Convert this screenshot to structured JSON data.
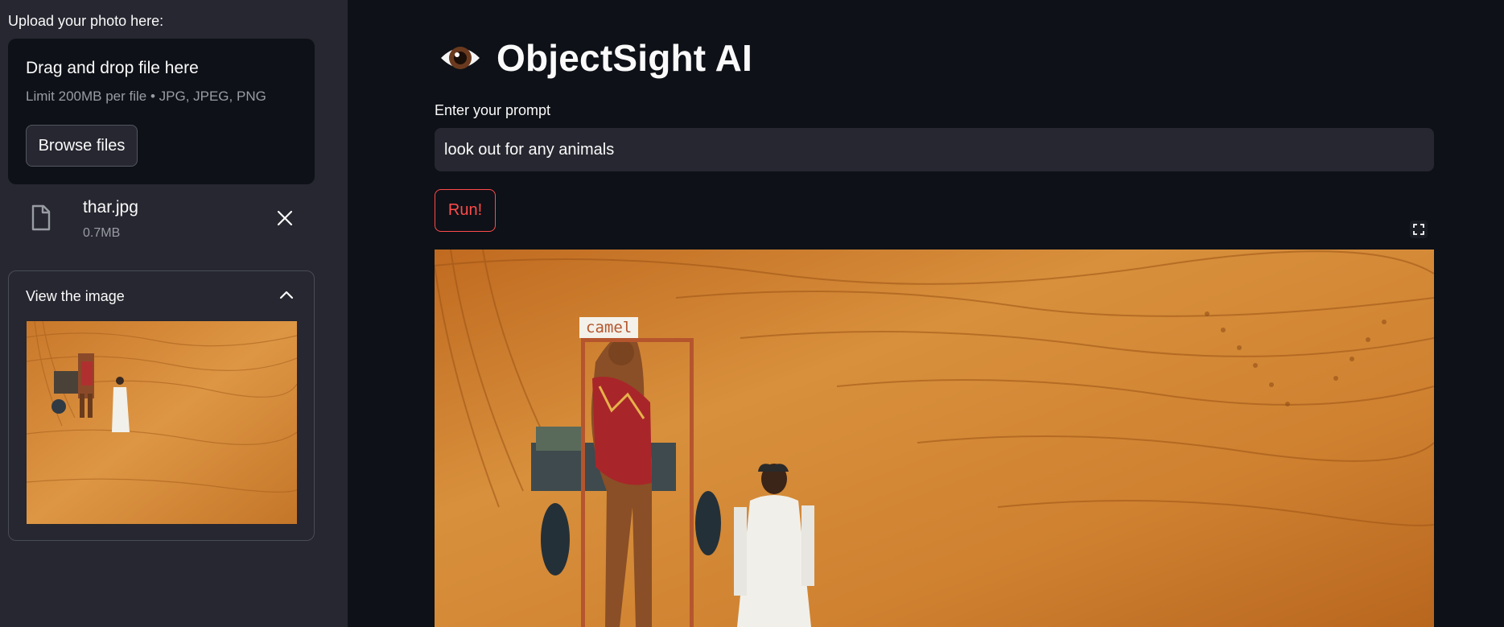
{
  "sidebar": {
    "upload_label": "Upload your photo here:",
    "dropzone": {
      "title": "Drag and drop file here",
      "limit": "Limit 200MB per file • JPG, JPEG, PNG",
      "browse_label": "Browse files"
    },
    "file": {
      "name": "thar.jpg",
      "size": "0.7MB",
      "icon": "file-icon"
    },
    "expander": {
      "title": "View the image",
      "expanded": true
    }
  },
  "main": {
    "title": "ObjectSight AI",
    "title_icon": "eye-icon",
    "prompt": {
      "label": "Enter your prompt",
      "value": "look out for any animals"
    },
    "run_label": "Run!",
    "detections": [
      {
        "label": "camel"
      }
    ]
  },
  "colors": {
    "background": "#0e1117",
    "sidebar": "#262730",
    "accent": "#ff4b4b",
    "box": "#b5552e",
    "sand": "#d58a33"
  }
}
